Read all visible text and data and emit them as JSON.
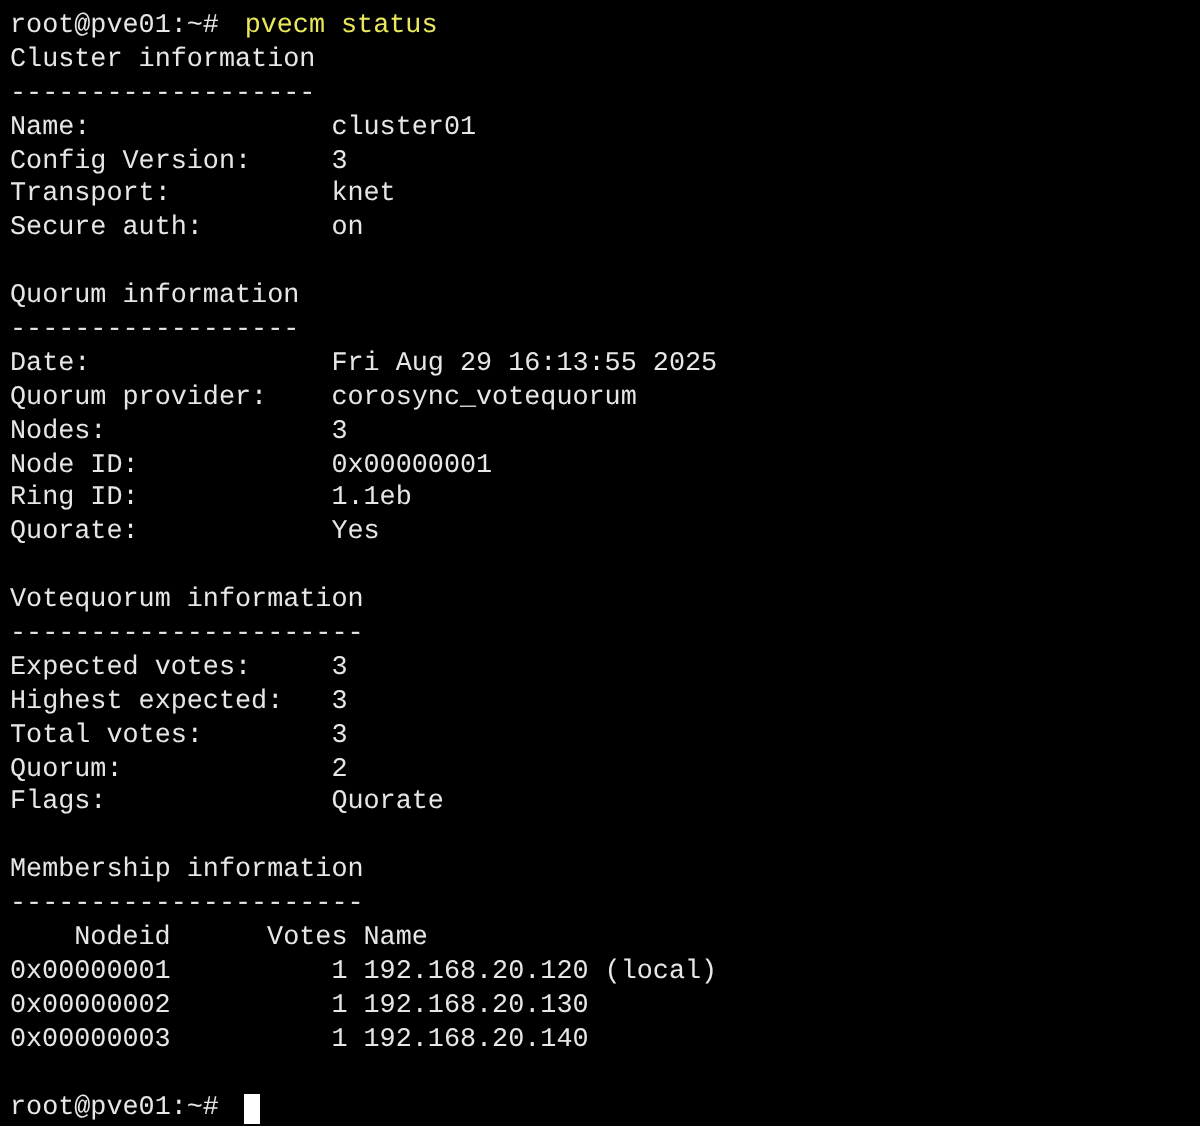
{
  "command_line": {
    "prompt": "root@pve01:~#",
    "command": "pvecm status"
  },
  "sections": [
    {
      "kind": "fields",
      "heading": "Cluster information",
      "rule": "-------------------",
      "fields": [
        {
          "label": "Name:",
          "value": "cluster01"
        },
        {
          "label": "Config Version:",
          "value": "3"
        },
        {
          "label": "Transport:",
          "value": "knet"
        },
        {
          "label": "Secure auth:",
          "value": "on"
        }
      ]
    },
    {
      "kind": "fields",
      "heading": "Quorum information",
      "rule": "------------------",
      "fields": [
        {
          "label": "Date:",
          "value": "Fri Aug 29 16:13:55 2025"
        },
        {
          "label": "Quorum provider:",
          "value": "corosync_votequorum"
        },
        {
          "label": "Nodes:",
          "value": "3"
        },
        {
          "label": "Node ID:",
          "value": "0x00000001"
        },
        {
          "label": "Ring ID:",
          "value": "1.1eb"
        },
        {
          "label": "Quorate:",
          "value": "Yes"
        }
      ]
    },
    {
      "kind": "fields",
      "heading": "Votequorum information",
      "rule": "----------------------",
      "fields": [
        {
          "label": "Expected votes:",
          "value": "3"
        },
        {
          "label": "Highest expected:",
          "value": "3"
        },
        {
          "label": "Total votes:",
          "value": "3"
        },
        {
          "label": "Quorum:",
          "value": "2"
        },
        {
          "label": "Flags:",
          "value": "Quorate"
        }
      ]
    },
    {
      "kind": "table",
      "heading": "Membership information",
      "rule": "----------------------",
      "columns": [
        "Nodeid",
        "Votes",
        "Name"
      ],
      "rows": [
        [
          "0x00000001",
          "1",
          "192.168.20.120 (local)"
        ],
        [
          "0x00000002",
          "1",
          "192.168.20.130"
        ],
        [
          "0x00000003",
          "1",
          "192.168.20.140"
        ]
      ]
    }
  ],
  "final_prompt": {
    "prompt": "root@pve01:~#"
  }
}
